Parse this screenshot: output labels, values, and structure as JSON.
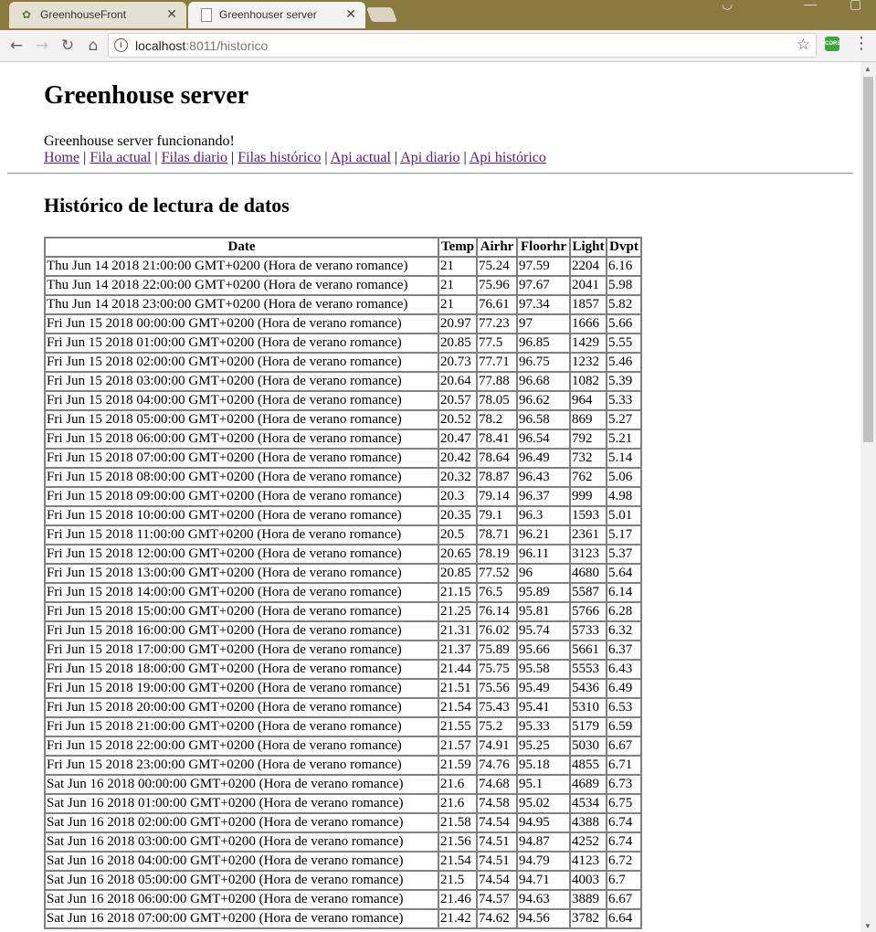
{
  "browser": {
    "tabs": [
      {
        "title": "GreenhouseFront",
        "active": false
      },
      {
        "title": "Greenhouser server",
        "active": true
      }
    ],
    "url_host": "localhost",
    "url_path": ":8011/historico",
    "extension_label": "CORS"
  },
  "page": {
    "heading": "Greenhouse server",
    "status": "Greenhouse server funcionando!",
    "nav": [
      {
        "label": "Home"
      },
      {
        "label": "Fila actual"
      },
      {
        "label": "Filas diario"
      },
      {
        "label": "Filas histórico"
      },
      {
        "label": "Api actual"
      },
      {
        "label": "Api diario"
      },
      {
        "label": "Api histórico"
      }
    ],
    "separator": "|",
    "section_title": "Histórico de lectura de datos"
  },
  "table": {
    "headers": [
      "Date",
      "Temp",
      "Airhr",
      "Floorhr",
      "Light",
      "Dvpt"
    ],
    "rows": [
      [
        "Thu Jun 14 2018 21:00:00 GMT+0200 (Hora de verano romance)",
        "21",
        "75.24",
        "97.59",
        "2204",
        "6.16"
      ],
      [
        "Thu Jun 14 2018 22:00:00 GMT+0200 (Hora de verano romance)",
        "21",
        "75.96",
        "97.67",
        "2041",
        "5.98"
      ],
      [
        "Thu Jun 14 2018 23:00:00 GMT+0200 (Hora de verano romance)",
        "21",
        "76.61",
        "97.34",
        "1857",
        "5.82"
      ],
      [
        "Fri Jun 15 2018 00:00:00 GMT+0200 (Hora de verano romance)",
        "20.97",
        "77.23",
        "97",
        "1666",
        "5.66"
      ],
      [
        "Fri Jun 15 2018 01:00:00 GMT+0200 (Hora de verano romance)",
        "20.85",
        "77.5",
        "96.85",
        "1429",
        "5.55"
      ],
      [
        "Fri Jun 15 2018 02:00:00 GMT+0200 (Hora de verano romance)",
        "20.73",
        "77.71",
        "96.75",
        "1232",
        "5.46"
      ],
      [
        "Fri Jun 15 2018 03:00:00 GMT+0200 (Hora de verano romance)",
        "20.64",
        "77.88",
        "96.68",
        "1082",
        "5.39"
      ],
      [
        "Fri Jun 15 2018 04:00:00 GMT+0200 (Hora de verano romance)",
        "20.57",
        "78.05",
        "96.62",
        "964",
        "5.33"
      ],
      [
        "Fri Jun 15 2018 05:00:00 GMT+0200 (Hora de verano romance)",
        "20.52",
        "78.2",
        "96.58",
        "869",
        "5.27"
      ],
      [
        "Fri Jun 15 2018 06:00:00 GMT+0200 (Hora de verano romance)",
        "20.47",
        "78.41",
        "96.54",
        "792",
        "5.21"
      ],
      [
        "Fri Jun 15 2018 07:00:00 GMT+0200 (Hora de verano romance)",
        "20.42",
        "78.64",
        "96.49",
        "732",
        "5.14"
      ],
      [
        "Fri Jun 15 2018 08:00:00 GMT+0200 (Hora de verano romance)",
        "20.32",
        "78.87",
        "96.43",
        "762",
        "5.06"
      ],
      [
        "Fri Jun 15 2018 09:00:00 GMT+0200 (Hora de verano romance)",
        "20.3",
        "79.14",
        "96.37",
        "999",
        "4.98"
      ],
      [
        "Fri Jun 15 2018 10:00:00 GMT+0200 (Hora de verano romance)",
        "20.35",
        "79.1",
        "96.3",
        "1593",
        "5.01"
      ],
      [
        "Fri Jun 15 2018 11:00:00 GMT+0200 (Hora de verano romance)",
        "20.5",
        "78.71",
        "96.21",
        "2361",
        "5.17"
      ],
      [
        "Fri Jun 15 2018 12:00:00 GMT+0200 (Hora de verano romance)",
        "20.65",
        "78.19",
        "96.11",
        "3123",
        "5.37"
      ],
      [
        "Fri Jun 15 2018 13:00:00 GMT+0200 (Hora de verano romance)",
        "20.85",
        "77.52",
        "96",
        "4680",
        "5.64"
      ],
      [
        "Fri Jun 15 2018 14:00:00 GMT+0200 (Hora de verano romance)",
        "21.15",
        "76.5",
        "95.89",
        "5587",
        "6.14"
      ],
      [
        "Fri Jun 15 2018 15:00:00 GMT+0200 (Hora de verano romance)",
        "21.25",
        "76.14",
        "95.81",
        "5766",
        "6.28"
      ],
      [
        "Fri Jun 15 2018 16:00:00 GMT+0200 (Hora de verano romance)",
        "21.31",
        "76.02",
        "95.74",
        "5733",
        "6.32"
      ],
      [
        "Fri Jun 15 2018 17:00:00 GMT+0200 (Hora de verano romance)",
        "21.37",
        "75.89",
        "95.66",
        "5661",
        "6.37"
      ],
      [
        "Fri Jun 15 2018 18:00:00 GMT+0200 (Hora de verano romance)",
        "21.44",
        "75.75",
        "95.58",
        "5553",
        "6.43"
      ],
      [
        "Fri Jun 15 2018 19:00:00 GMT+0200 (Hora de verano romance)",
        "21.51",
        "75.56",
        "95.49",
        "5436",
        "6.49"
      ],
      [
        "Fri Jun 15 2018 20:00:00 GMT+0200 (Hora de verano romance)",
        "21.54",
        "75.43",
        "95.41",
        "5310",
        "6.53"
      ],
      [
        "Fri Jun 15 2018 21:00:00 GMT+0200 (Hora de verano romance)",
        "21.55",
        "75.2",
        "95.33",
        "5179",
        "6.59"
      ],
      [
        "Fri Jun 15 2018 22:00:00 GMT+0200 (Hora de verano romance)",
        "21.57",
        "74.91",
        "95.25",
        "5030",
        "6.67"
      ],
      [
        "Fri Jun 15 2018 23:00:00 GMT+0200 (Hora de verano romance)",
        "21.59",
        "74.76",
        "95.18",
        "4855",
        "6.71"
      ],
      [
        "Sat Jun 16 2018 00:00:00 GMT+0200 (Hora de verano romance)",
        "21.6",
        "74.68",
        "95.1",
        "4689",
        "6.73"
      ],
      [
        "Sat Jun 16 2018 01:00:00 GMT+0200 (Hora de verano romance)",
        "21.6",
        "74.58",
        "95.02",
        "4534",
        "6.75"
      ],
      [
        "Sat Jun 16 2018 02:00:00 GMT+0200 (Hora de verano romance)",
        "21.58",
        "74.54",
        "94.95",
        "4388",
        "6.74"
      ],
      [
        "Sat Jun 16 2018 03:00:00 GMT+0200 (Hora de verano romance)",
        "21.56",
        "74.51",
        "94.87",
        "4252",
        "6.74"
      ],
      [
        "Sat Jun 16 2018 04:00:00 GMT+0200 (Hora de verano romance)",
        "21.54",
        "74.51",
        "94.79",
        "4123",
        "6.72"
      ],
      [
        "Sat Jun 16 2018 05:00:00 GMT+0200 (Hora de verano romance)",
        "21.5",
        "74.54",
        "94.71",
        "4003",
        "6.7"
      ],
      [
        "Sat Jun 16 2018 06:00:00 GMT+0200 (Hora de verano romance)",
        "21.46",
        "74.57",
        "94.63",
        "3889",
        "6.67"
      ],
      [
        "Sat Jun 16 2018 07:00:00 GMT+0200 (Hora de verano romance)",
        "21.42",
        "74.62",
        "94.56",
        "3782",
        "6.64"
      ]
    ]
  }
}
